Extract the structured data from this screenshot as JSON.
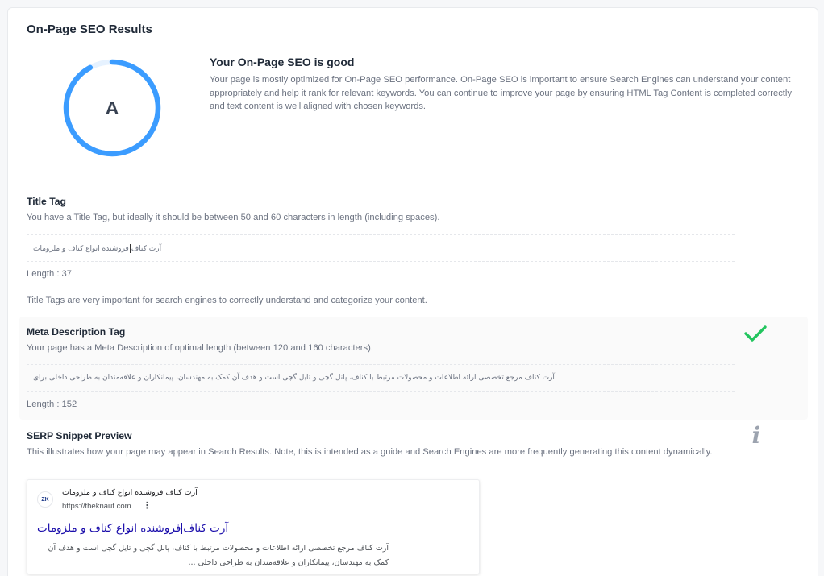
{
  "results": {
    "title": "On-Page SEO Results",
    "grade": "A",
    "grade_score": 0.92,
    "ring_color": "#3b9cff",
    "ring_track_color": "#e6f2ff",
    "summary_title": "Your On-Page SEO is good",
    "summary_text": "Your page is mostly optimized for On-Page SEO performance. On-Page SEO is important to ensure Search Engines can understand your content appropriately and help it rank for relevant keywords. You can continue to improve your page by ensuring HTML Tag Content is completed correctly and text content is well aligned with chosen keywords."
  },
  "title_tag": {
    "title": "Title Tag",
    "description": "You have a Title Tag, but ideally it should be between 50 and 60 characters in length (including spaces).",
    "value_part1": "آرت کناف",
    "value_part2": "فروشنده انواع کناف و ملزومات",
    "length": "Length : 37",
    "note": "Title Tags are very important for search engines to correctly understand and categorize your content."
  },
  "meta_description": {
    "title": "Meta Description Tag",
    "description": "Your page has a Meta Description of optimal length (between 120 and 160 characters).",
    "value": "آرت کناف مرجع تخصصی ارائه اطلاعات و محصولات مرتبط با کناف، پانل گچی و تایل گچی است و هدف آن کمک به مهندسان، پیمانکاران و علاقه‌مندان به طراحی داخلی برای",
    "length": "Length : 152",
    "status_icon": "check-icon",
    "status_color": "#22c55e"
  },
  "serp": {
    "title": "SERP Snippet Preview",
    "description": "This illustrates how your page may appear in Search Results. Note, this is intended as a guide and Search Engines are more frequently generating this content dynamically.",
    "info_icon": "info-icon",
    "favicon_text": "ZK",
    "site_name_part1": "آرت کناف",
    "site_name_part2": "فروشنده انواع کناف و ملزومات",
    "url": "https://theknauf.com",
    "menu_icon": "kebab-menu-icon",
    "link_title_part1": "آرت کناف",
    "link_title_part2": "فروشنده انواع کناف و ملزومات",
    "snippet": "آرت کناف مرجع تخصصی ارائه اطلاعات و محصولات مرتبط با کناف، پانل گچی و تایل گچی است و هدف آن کمک به مهندسان، پیمانکاران و علاقه‌مندان به طراحی داخلی ..."
  }
}
